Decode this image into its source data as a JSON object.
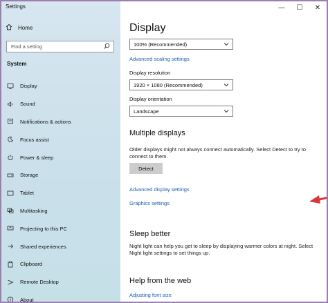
{
  "app": {
    "title": "Settings"
  },
  "window_controls": {
    "minimize": "—",
    "maximize": "☐",
    "close": "✕"
  },
  "sidebar": {
    "home_label": "Home",
    "search_placeholder": "Find a setting",
    "section": "System",
    "items": [
      {
        "label": "Display",
        "icon": "monitor-icon"
      },
      {
        "label": "Sound",
        "icon": "speaker-icon"
      },
      {
        "label": "Notifications & actions",
        "icon": "notification-icon"
      },
      {
        "label": "Focus assist",
        "icon": "moon-icon"
      },
      {
        "label": "Power & sleep",
        "icon": "power-icon"
      },
      {
        "label": "Storage",
        "icon": "storage-icon"
      },
      {
        "label": "Tablet",
        "icon": "tablet-icon"
      },
      {
        "label": "Multitasking",
        "icon": "multitasking-icon"
      },
      {
        "label": "Projecting to this PC",
        "icon": "projecting-icon"
      },
      {
        "label": "Shared experiences",
        "icon": "shared-icon"
      },
      {
        "label": "Clipboard",
        "icon": "clipboard-icon"
      },
      {
        "label": "Remote Desktop",
        "icon": "remote-desktop-icon"
      },
      {
        "label": "About",
        "icon": "info-icon"
      }
    ]
  },
  "main": {
    "title": "Display",
    "scale_value": "100% (Recommended)",
    "advanced_scaling_link": "Advanced scaling settings",
    "resolution_label": "Display resolution",
    "resolution_value": "1920 × 1080 (Recommended)",
    "orientation_label": "Display orientation",
    "orientation_value": "Landscape",
    "multiple_displays_title": "Multiple displays",
    "multiple_displays_text": "Older displays might not always connect automatically. Select Detect to try to connect to them.",
    "detect_button": "Detect",
    "advanced_display_link": "Advanced display settings",
    "graphics_link": "Graphics settings",
    "sleep_title": "Sleep better",
    "sleep_text": "Night light can help you get to sleep by displaying warmer colors at night. Select Night light settings to set things up.",
    "help_title": "Help from the web",
    "font_size_link": "Adjusting font size"
  },
  "colors": {
    "link": "#1a5fb4",
    "annotation_arrow": "#d9363e",
    "window_border": "#9b7fb0"
  }
}
